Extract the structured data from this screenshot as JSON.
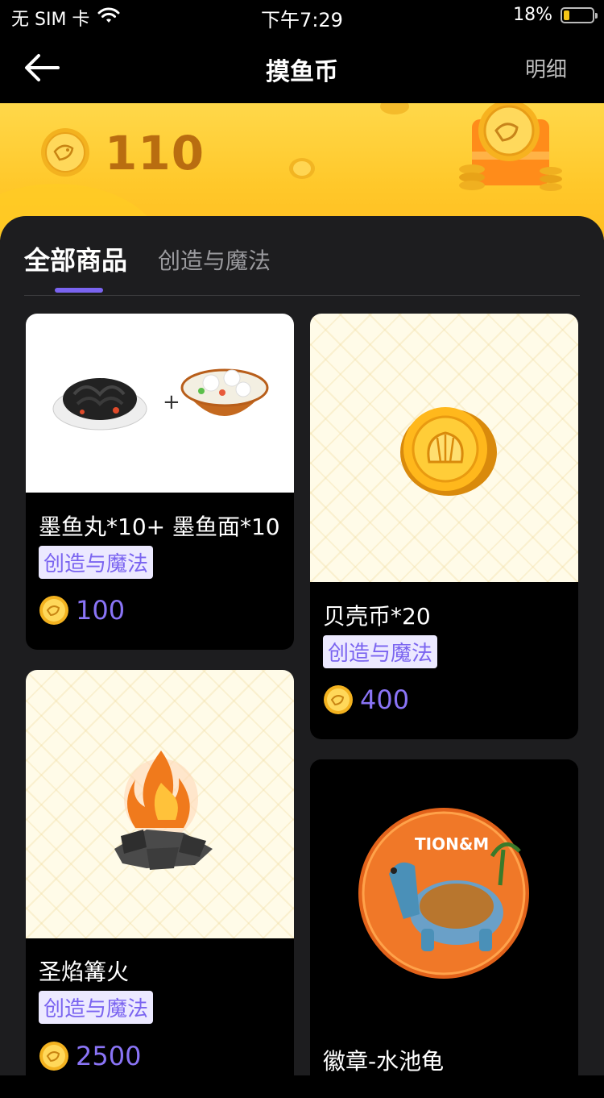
{
  "status_bar": {
    "carrier": "无 SIM 卡",
    "time": "下午7:29",
    "battery": "18%",
    "battery_level": 0.18,
    "wifi_icon": "wifi-icon"
  },
  "nav": {
    "back_icon": "arrow-left-icon",
    "title": "摸鱼币",
    "detail_label": "明细"
  },
  "banner": {
    "balance": "110",
    "coin_icon": "fish-coin-icon",
    "decoration": "treasure-chest-icon"
  },
  "tabs": [
    {
      "label": "全部商品",
      "active": true
    },
    {
      "label": "创造与魔法",
      "active": false
    }
  ],
  "colors": {
    "accent": "#7a64f0",
    "banner_yellow": "#ffc82a",
    "balance_text": "#b96d10",
    "panel_bg": "#1d1d1f",
    "tag_bg": "#ece9ff"
  },
  "products": [
    {
      "name": "墨鱼丸*10+ 墨鱼面*10",
      "tag": "创造与魔法",
      "price": "100",
      "image": "squid-noodles-and-meatballs-image"
    },
    {
      "name": "贝壳币*20",
      "tag": "创造与魔法",
      "price": "400",
      "image": "shell-coin-image"
    },
    {
      "name": "圣焰篝火",
      "tag": "创造与魔法",
      "price": "2500",
      "image": "bonfire-image"
    },
    {
      "name": "徽章-水池龟",
      "tag": "",
      "price": "",
      "image": "pool-turtle-badge-image"
    }
  ]
}
